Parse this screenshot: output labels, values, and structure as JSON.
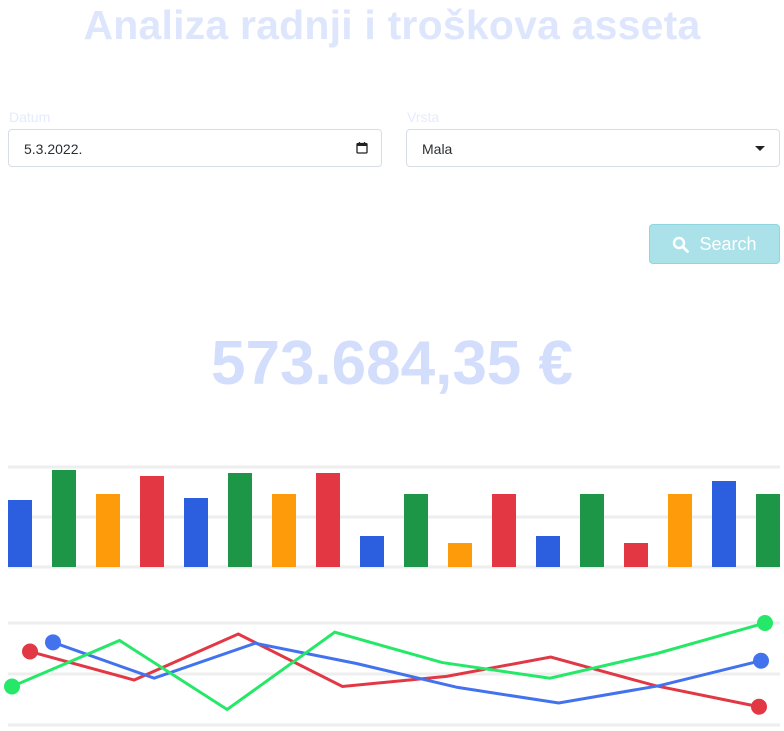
{
  "header": {
    "title": "Analiza radnji i troškova asseta"
  },
  "filters": {
    "date_label": "Datum",
    "date_value": "5.3.2022.",
    "type_label": "Vrsta",
    "type_value": "Mala"
  },
  "actions": {
    "search_label": "Search"
  },
  "summary": {
    "total": "573.684,35 €"
  },
  "colors": {
    "blue": "#2c5fe0",
    "green": "#1d9747",
    "orange": "#fd9b0b",
    "red": "#e33843",
    "line_blue": "#4372ee",
    "line_red": "#e23744",
    "line_green": "#26e868"
  },
  "chart_data": [
    {
      "type": "bar",
      "categories": [
        "",
        "",
        "",
        "",
        "",
        "",
        "",
        "",
        "",
        "",
        "",
        "",
        "",
        "",
        "",
        "",
        "",
        ""
      ],
      "values": [
        67,
        97,
        73,
        91,
        69,
        94,
        73,
        94,
        31,
        73,
        24,
        73,
        31,
        73,
        24,
        73,
        86,
        73
      ],
      "bar_colors": [
        "blue",
        "green",
        "orange",
        "red",
        "blue",
        "green",
        "orange",
        "red",
        "blue",
        "green",
        "orange",
        "red",
        "blue",
        "green",
        "red",
        "orange",
        "blue",
        "green"
      ],
      "ylim": [
        0,
        100
      ],
      "grid": true
    },
    {
      "type": "line",
      "x": [
        0,
        1,
        2,
        3,
        4,
        5,
        6,
        7
      ],
      "ylim": [
        0,
        100
      ],
      "grid": true,
      "series": [
        {
          "color": "line_red",
          "x": [
            0,
            1,
            2,
            3,
            4,
            5,
            6,
            7
          ],
          "values": [
            69,
            38,
            88,
            31,
            42,
            63,
            32,
            9
          ]
        },
        {
          "color": "line_blue",
          "x": [
            0,
            1,
            2,
            3,
            4,
            5,
            6,
            7
          ],
          "values": [
            79,
            40,
            78,
            56,
            30,
            13,
            32,
            59
          ]
        },
        {
          "color": "line_green",
          "x": [
            0,
            1,
            2,
            3,
            4,
            5,
            6,
            7
          ],
          "values": [
            31,
            81,
            6,
            90,
            57,
            40,
            67,
            100
          ]
        }
      ]
    }
  ]
}
